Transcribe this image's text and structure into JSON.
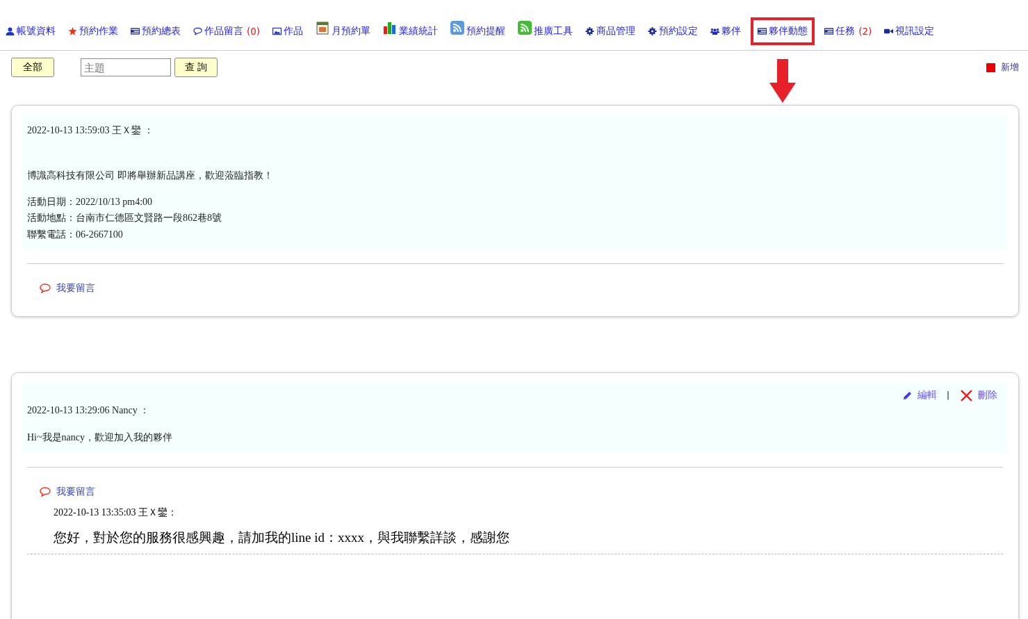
{
  "nav": [
    {
      "label": "帳號資料",
      "kind": "person",
      "highlighted": false
    },
    {
      "label": "預約作業",
      "kind": "star",
      "highlighted": false
    },
    {
      "label": "預約總表",
      "kind": "list",
      "highlighted": false
    },
    {
      "label": "作品留言",
      "count": "(0)",
      "kind": "comment",
      "highlighted": false
    },
    {
      "label": "作品",
      "kind": "image",
      "highlighted": false
    },
    {
      "label": "月預約單",
      "kind": "calendar",
      "highlighted": false
    },
    {
      "label": "業績統計",
      "kind": "chart",
      "highlighted": false
    },
    {
      "label": "預約提醒",
      "kind": "rss",
      "highlighted": false
    },
    {
      "label": "推廣工具",
      "kind": "rss",
      "highlighted": false
    },
    {
      "label": "商品管理",
      "kind": "gear",
      "highlighted": false
    },
    {
      "label": "預約設定",
      "kind": "gear",
      "highlighted": false
    },
    {
      "label": "夥伴",
      "kind": "group",
      "highlighted": false
    },
    {
      "label": "夥伴動態",
      "kind": "list",
      "highlighted": true
    },
    {
      "label": "任務",
      "count": "(2)",
      "kind": "list",
      "highlighted": false
    },
    {
      "label": "視訊設定",
      "kind": "video",
      "highlighted": false
    }
  ],
  "toolbar": {
    "all_button": "全部",
    "search": {
      "placeholder": "主題"
    },
    "search_button": "查 詢",
    "add_link": "新增"
  },
  "posts": [
    {
      "header": "2022-10-13 13:59:03 王Ｘ鑾 ：",
      "body": [
        [
          "博識高科技有限公司 即將舉辦新品講座，歡迎蒞臨指教！"
        ],
        [
          "活動日期：2022/10/13  pm4:00",
          "活動地點：台南市仁德區文賢路一段862巷8號",
          "聯繫電話：06-2667100"
        ]
      ],
      "comment_link": "我要留言"
    },
    {
      "header": "2022-10-13 13:29:06 Nancy ：",
      "actions": [
        {
          "kind": "edit",
          "label": "編輯"
        },
        {
          "kind": "delete",
          "label": "刪除"
        }
      ],
      "action_separator": "|",
      "body": [
        [
          "Hi~我是nancy，歡迎加入我的夥伴"
        ]
      ],
      "comment_link": "我要留言",
      "replies": [
        {
          "header": "2022-10-13 13:35:03 王Ｘ鑾：",
          "text": "您好，對於您的服務很感興趣，請加我的line id：xxxx，與我聯繫詳談，感謝您"
        }
      ]
    }
  ]
}
